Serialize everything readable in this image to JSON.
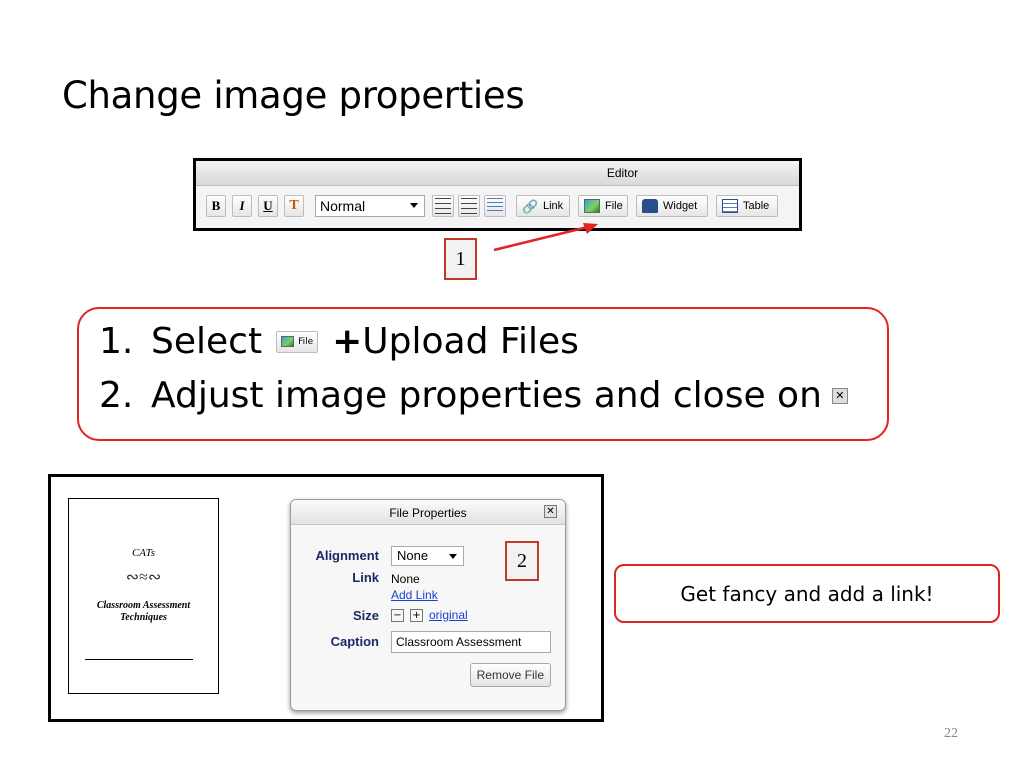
{
  "slide": {
    "title": "Change image properties",
    "page_number": "22"
  },
  "editor": {
    "title": "Editor",
    "toolbar": {
      "bold": "B",
      "italic": "I",
      "underline": "U",
      "style_select": "Normal",
      "link_label": "Link",
      "file_label": "File",
      "widget_label": "Widget",
      "table_label": "Table"
    }
  },
  "markers": {
    "one": "1",
    "two": "2"
  },
  "instructions": {
    "step1_num": "1.",
    "step1_text": "Select",
    "step1_plus": "+",
    "step1_rest": "Upload Files",
    "step2_num": "2.",
    "step2_text": "Adjust image properties and close on",
    "file_chip_label": "File"
  },
  "document": {
    "title": "CATs",
    "ornament": "∾≈∾",
    "subtitle": "Classroom Assessment Techniques"
  },
  "file_properties": {
    "title": "File Properties",
    "alignment_label": "Alignment",
    "alignment_value": "None",
    "link_label": "Link",
    "link_value": "None",
    "add_link": "Add Link",
    "size_label": "Size",
    "size_original": "original",
    "caption_label": "Caption",
    "caption_value": "Classroom Assessment",
    "remove_button": "Remove File"
  },
  "tip": {
    "text": "Get fancy and add a link!"
  },
  "colors": {
    "accent_red": "#e02424",
    "link_blue": "#1a3fd1"
  }
}
